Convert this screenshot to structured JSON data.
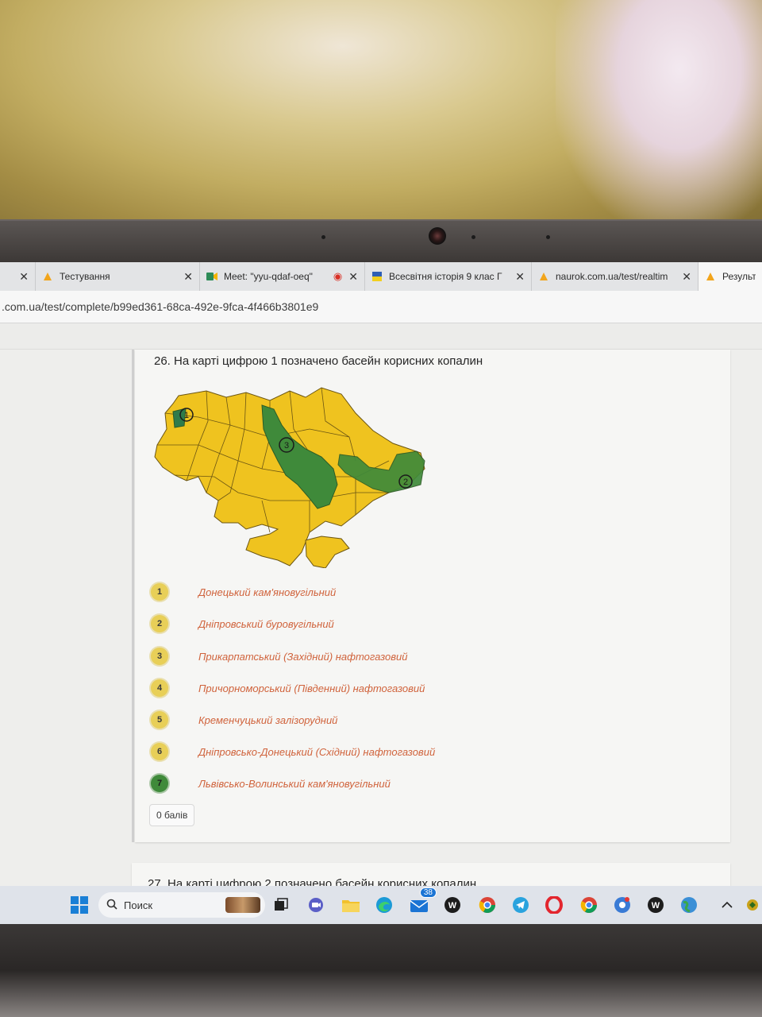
{
  "browser": {
    "tabs": [
      {
        "label": "",
        "icon": "tab-icon"
      },
      {
        "label": "Тестування",
        "icon": "naurok-icon"
      },
      {
        "label": "Meet: \"yyu-qdaf-oeq\"",
        "icon": "meet-icon"
      },
      {
        "label": "Всесвітня історія 9 клас Г",
        "icon": "ukraine-flag-icon"
      },
      {
        "label": "naurok.com.ua/test/realtim",
        "icon": "naurok-icon"
      },
      {
        "label": "Результа",
        "icon": "naurok-icon"
      }
    ],
    "address": ".com.ua/test/complete/b99ed361-68ca-492e-9fca-4f466b3801e9"
  },
  "question": {
    "title": "26. На карті цифрою 1 позначено басейн корисних копалин",
    "map_labels": [
      "1",
      "2",
      "3"
    ],
    "answers": [
      {
        "num": "1",
        "text": "Донецький кам'яновугільний",
        "selected": false
      },
      {
        "num": "2",
        "text": "Дніпровський буровугільний",
        "selected": false
      },
      {
        "num": "3",
        "text": "Прикарпатський (Західний) нафтогазовий",
        "selected": false
      },
      {
        "num": "4",
        "text": "Причорноморський (Південний) нафтогазовий",
        "selected": false
      },
      {
        "num": "5",
        "text": "Кременчуцький залізорудний",
        "selected": false
      },
      {
        "num": "6",
        "text": "Дніпровсько-Донецький (Східний) нафтогазовий",
        "selected": false
      },
      {
        "num": "7",
        "text": "Львівсько-Волинський кам'яновугільний",
        "selected": true
      }
    ],
    "score": "0 балів"
  },
  "next_question": {
    "title": "27. На карті цифрою 2 позначено басейн корисних копалин"
  },
  "taskbar": {
    "search_placeholder": "Поиск",
    "mail_badge": "38"
  },
  "colors": {
    "map_yellow": "#efc31f",
    "map_green": "#3f8a3a",
    "answer_text": "#d0633c"
  }
}
